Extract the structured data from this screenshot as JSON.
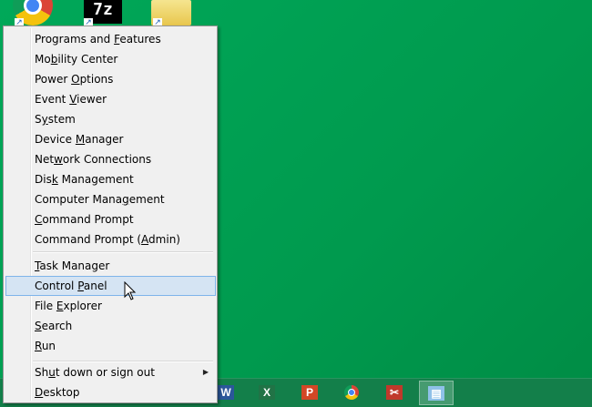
{
  "desktop": {
    "icons": [
      {
        "name": "Google Chrome"
      },
      {
        "name": "7-Zip",
        "text": "7z"
      },
      {
        "name": "Folder"
      }
    ]
  },
  "menu": {
    "groups": [
      [
        {
          "pre": "Programs and ",
          "key": "F",
          "post": "eatures"
        },
        {
          "pre": "Mo",
          "key": "b",
          "post": "ility Center"
        },
        {
          "pre": "Power ",
          "key": "O",
          "post": "ptions"
        },
        {
          "pre": "Event ",
          "key": "V",
          "post": "iewer"
        },
        {
          "pre": "S",
          "key": "y",
          "post": "stem"
        },
        {
          "pre": "Device ",
          "key": "M",
          "post": "anager"
        },
        {
          "pre": "Net",
          "key": "w",
          "post": "ork Connections"
        },
        {
          "pre": "Dis",
          "key": "k",
          "post": " Management"
        },
        {
          "pre": "Computer Mana",
          "key": "g",
          "post": "ement"
        },
        {
          "pre": "",
          "key": "C",
          "post": "ommand Prompt"
        },
        {
          "pre": "Command Prompt (",
          "key": "A",
          "post": "dmin)"
        }
      ],
      [
        {
          "pre": "",
          "key": "T",
          "post": "ask Manager"
        },
        {
          "pre": "Control ",
          "key": "P",
          "post": "anel",
          "hover": true
        },
        {
          "pre": "File ",
          "key": "E",
          "post": "xplorer"
        },
        {
          "pre": "",
          "key": "S",
          "post": "earch"
        },
        {
          "pre": "",
          "key": "R",
          "post": "un"
        }
      ],
      [
        {
          "pre": "Sh",
          "key": "u",
          "post": "t down or sign out",
          "submenu": true
        },
        {
          "pre": "",
          "key": "D",
          "post": "esktop"
        }
      ]
    ]
  },
  "taskbar": {
    "apps": [
      {
        "name": "word",
        "glyph": "W",
        "color": "#2b579a"
      },
      {
        "name": "excel",
        "glyph": "X",
        "color": "#217346"
      },
      {
        "name": "powerpoint",
        "glyph": "P",
        "color": "#d24726"
      },
      {
        "name": "chrome",
        "glyph": "",
        "color": "#4285f4"
      },
      {
        "name": "snipping-tool",
        "glyph": "✂",
        "color": "#c0392b"
      },
      {
        "name": "notepad",
        "glyph": "▤",
        "color": "#8fc1e8",
        "active": true
      }
    ]
  }
}
